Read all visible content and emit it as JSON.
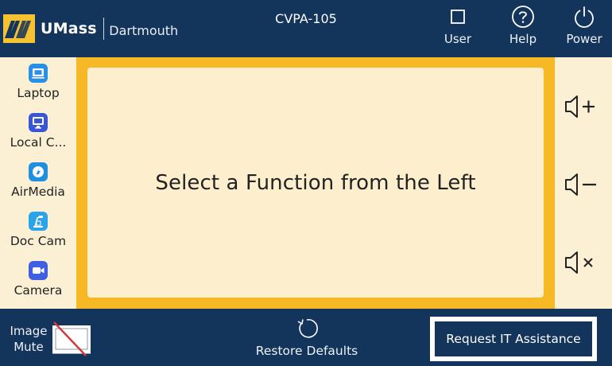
{
  "header": {
    "brand_name": "UMass",
    "brand_campus": "Dartmouth",
    "room": "CVPA-105",
    "buttons": [
      {
        "label": "User",
        "icon": "user-square-icon"
      },
      {
        "label": "Help",
        "icon": "help-circle-icon"
      },
      {
        "label": "Power",
        "icon": "power-icon"
      }
    ]
  },
  "sources": [
    {
      "label": "Laptop",
      "icon": "laptop-icon",
      "color": "#2a8fe6"
    },
    {
      "label": "Local C...",
      "icon": "monitor-icon",
      "color": "#3a56d8"
    },
    {
      "label": "AirMedia",
      "icon": "airmedia-icon",
      "color": "#1f8fe0"
    },
    {
      "label": "Doc Cam",
      "icon": "doc-cam-icon",
      "color": "#2aa3e8"
    },
    {
      "label": "Camera",
      "icon": "video-camera-icon",
      "color": "#3e5fe0"
    }
  ],
  "main": {
    "message": "Select a Function from the Left"
  },
  "volume": {
    "buttons": [
      {
        "icon": "volume-up-icon"
      },
      {
        "icon": "volume-down-icon"
      },
      {
        "icon": "volume-mute-icon"
      }
    ]
  },
  "footer": {
    "image_mute_label": "Image Mute",
    "image_mute_icon": "image-mute-icon",
    "restore_label": "Restore Defaults",
    "restore_icon": "restore-icon",
    "request_label": "Request IT Assistance"
  },
  "colors": {
    "navy": "#13345b",
    "gold": "#f7b826",
    "cream": "#fdefcd",
    "sidebar": "#fbf0d4"
  }
}
